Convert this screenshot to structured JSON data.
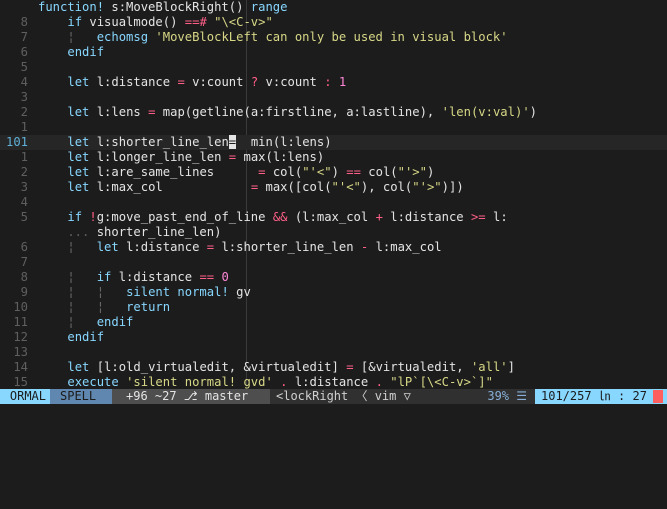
{
  "editor": {
    "lines": [
      {
        "num": "",
        "cur": false,
        "tokens": [
          [
            "t-kw",
            "function! "
          ],
          [
            "t-fn",
            "s:MoveBlockRight() "
          ],
          [
            "t-kw",
            "range"
          ]
        ]
      },
      {
        "num": "8",
        "cur": false,
        "tokens": [
          [
            "t-plain",
            "    "
          ],
          [
            "t-kw",
            "if "
          ],
          [
            "t-fn",
            "visualmode() "
          ],
          [
            "t-op",
            "==# "
          ],
          [
            "t-str",
            "\"\\<C-v>\""
          ]
        ]
      },
      {
        "num": "7",
        "cur": false,
        "tokens": [
          [
            "t-guide",
            "    ¦   "
          ],
          [
            "t-cmd",
            "echomsg "
          ],
          [
            "t-str",
            "'MoveBlockLeft can only be used in visual block'"
          ]
        ]
      },
      {
        "num": "6",
        "cur": false,
        "tokens": [
          [
            "t-plain",
            "    "
          ],
          [
            "t-kw",
            "endif"
          ]
        ]
      },
      {
        "num": "5",
        "cur": false,
        "tokens": []
      },
      {
        "num": "4",
        "cur": false,
        "tokens": [
          [
            "t-plain",
            "    "
          ],
          [
            "t-kw",
            "let "
          ],
          [
            "t-var",
            "l:distance "
          ],
          [
            "t-op",
            "= "
          ],
          [
            "t-var",
            "v:count "
          ],
          [
            "t-op",
            "? "
          ],
          [
            "t-var",
            "v:count "
          ],
          [
            "t-op",
            ": "
          ],
          [
            "t-num",
            "1"
          ]
        ]
      },
      {
        "num": "3",
        "cur": false,
        "tokens": []
      },
      {
        "num": "2",
        "cur": false,
        "tokens": [
          [
            "t-plain",
            "    "
          ],
          [
            "t-kw",
            "let "
          ],
          [
            "t-var",
            "l:lens "
          ],
          [
            "t-op",
            "= "
          ],
          [
            "t-fn",
            "map(getline(a:firstline, a:lastline), "
          ],
          [
            "t-str",
            "'len(v:val)'"
          ],
          [
            "t-fn",
            ")"
          ]
        ]
      },
      {
        "num": "1",
        "cur": false,
        "tokens": []
      },
      {
        "num": "101",
        "cur": true,
        "tokens": [
          [
            "t-plain",
            "    "
          ],
          [
            "t-kw",
            "let "
          ],
          [
            "t-var",
            "l:shorter_line_len"
          ],
          [
            "cursor",
            "="
          ],
          [
            "t-plain",
            "  "
          ],
          [
            "t-fn",
            "min(l:lens)"
          ]
        ]
      },
      {
        "num": "1",
        "cur": false,
        "tokens": [
          [
            "t-plain",
            "    "
          ],
          [
            "t-kw",
            "let "
          ],
          [
            "t-var",
            "l:longer_line_len "
          ],
          [
            "t-op",
            "= "
          ],
          [
            "t-fn",
            "max(l:lens)"
          ]
        ]
      },
      {
        "num": "2",
        "cur": false,
        "tokens": [
          [
            "t-plain",
            "    "
          ],
          [
            "t-kw",
            "let "
          ],
          [
            "t-var",
            "l:are_same_lines      "
          ],
          [
            "t-op",
            "= "
          ],
          [
            "t-fn",
            "col("
          ],
          [
            "t-str",
            "\"'<\""
          ],
          [
            "t-fn",
            ") "
          ],
          [
            "t-op",
            "== "
          ],
          [
            "t-fn",
            "col("
          ],
          [
            "t-str",
            "\"'>\""
          ],
          [
            "t-fn",
            ")"
          ]
        ]
      },
      {
        "num": "3",
        "cur": false,
        "tokens": [
          [
            "t-plain",
            "    "
          ],
          [
            "t-kw",
            "let "
          ],
          [
            "t-var",
            "l:max_col            "
          ],
          [
            "t-op",
            "= "
          ],
          [
            "t-fn",
            "max([col("
          ],
          [
            "t-str",
            "\"'<\""
          ],
          [
            "t-fn",
            "), col("
          ],
          [
            "t-str",
            "\"'>\""
          ],
          [
            "t-fn",
            ")])"
          ]
        ]
      },
      {
        "num": "4",
        "cur": false,
        "tokens": []
      },
      {
        "num": "5",
        "cur": false,
        "tokens": [
          [
            "t-plain",
            "    "
          ],
          [
            "t-kw",
            "if "
          ],
          [
            "t-op",
            "!"
          ],
          [
            "t-var",
            "g:move_past_end_of_line "
          ],
          [
            "t-op",
            "&& "
          ],
          [
            "t-fn",
            "(l:max_col "
          ],
          [
            "t-op",
            "+ "
          ],
          [
            "t-var",
            "l:distance "
          ],
          [
            "t-op",
            ">= "
          ],
          [
            "t-var",
            "l:"
          ]
        ]
      },
      {
        "num": "",
        "cur": false,
        "tokens": [
          [
            "t-ellip",
            "    ... "
          ],
          [
            "t-var",
            "shorter_line_len)"
          ]
        ]
      },
      {
        "num": "6",
        "cur": false,
        "tokens": [
          [
            "t-guide",
            "    ¦   "
          ],
          [
            "t-kw",
            "let "
          ],
          [
            "t-var",
            "l:distance "
          ],
          [
            "t-op",
            "= "
          ],
          [
            "t-var",
            "l:shorter_line_len "
          ],
          [
            "t-op",
            "- "
          ],
          [
            "t-var",
            "l:max_col"
          ]
        ]
      },
      {
        "num": "7",
        "cur": false,
        "tokens": []
      },
      {
        "num": "8",
        "cur": false,
        "tokens": [
          [
            "t-guide",
            "    ¦   "
          ],
          [
            "t-kw",
            "if "
          ],
          [
            "t-var",
            "l:distance "
          ],
          [
            "t-op",
            "== "
          ],
          [
            "t-num",
            "0"
          ]
        ]
      },
      {
        "num": "9",
        "cur": false,
        "tokens": [
          [
            "t-guide",
            "    ¦   ¦   "
          ],
          [
            "t-cmd",
            "silent normal! "
          ],
          [
            "t-var",
            "gv"
          ]
        ]
      },
      {
        "num": "10",
        "cur": false,
        "tokens": [
          [
            "t-guide",
            "    ¦   ¦   "
          ],
          [
            "t-kw",
            "return"
          ]
        ]
      },
      {
        "num": "11",
        "cur": false,
        "tokens": [
          [
            "t-guide",
            "    ¦   "
          ],
          [
            "t-kw",
            "endif"
          ]
        ]
      },
      {
        "num": "12",
        "cur": false,
        "tokens": [
          [
            "t-plain",
            "    "
          ],
          [
            "t-kw",
            "endif"
          ]
        ]
      },
      {
        "num": "13",
        "cur": false,
        "tokens": []
      },
      {
        "num": "14",
        "cur": false,
        "tokens": [
          [
            "t-plain",
            "    "
          ],
          [
            "t-kw",
            "let "
          ],
          [
            "t-fn",
            "[l:old_virtualedit, &virtualedit] "
          ],
          [
            "t-op",
            "= "
          ],
          [
            "t-fn",
            "[&virtualedit, "
          ],
          [
            "t-str",
            "'all'"
          ],
          [
            "t-fn",
            "]"
          ]
        ]
      },
      {
        "num": "15",
        "cur": false,
        "tokens": [
          [
            "t-plain",
            "    "
          ],
          [
            "t-cmd",
            "execute "
          ],
          [
            "t-str",
            "'silent normal! gvd' "
          ],
          [
            "t-op",
            ". "
          ],
          [
            "t-var",
            "l:distance "
          ],
          [
            "t-op",
            ". "
          ],
          [
            "t-str",
            "\"lP`[\\<C-v>`]\""
          ]
        ]
      }
    ]
  },
  "statusline": {
    "mode": "ORMAL",
    "spell": "SPELL",
    "git": "+96 ~27 ⎇ master",
    "file": "<lockRight 〈 vim ▽",
    "percent": "39% ☰",
    "position": "101/257 ㏑ : 27"
  }
}
